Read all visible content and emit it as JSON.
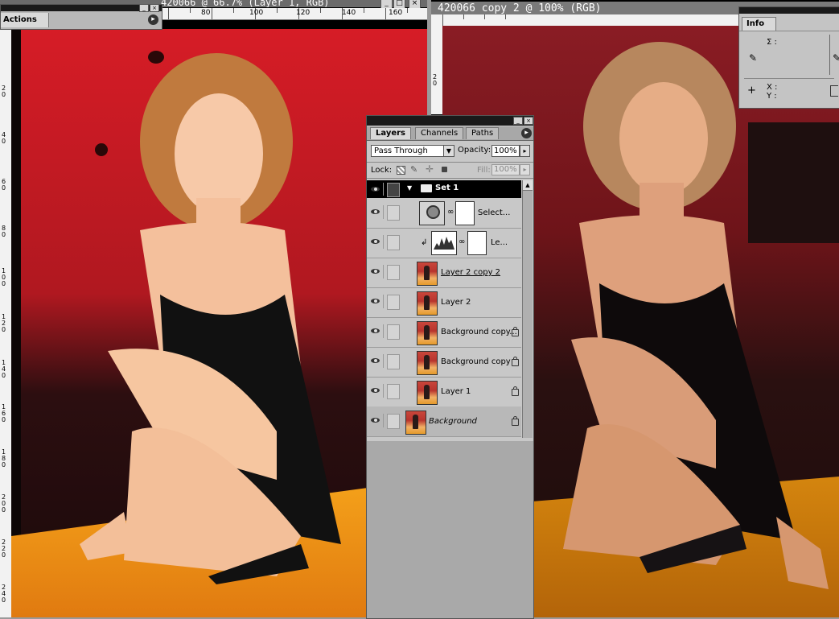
{
  "left_window": {
    "title": "420066 @ 66.7% (Layer 1, RGB)",
    "ruler_labels": [
      "80",
      "100",
      "120",
      "140",
      "160"
    ],
    "vruler_labels": [
      "20",
      "40",
      "60",
      "80",
      "100",
      "120",
      "140",
      "160",
      "180",
      "200",
      "220",
      "240"
    ],
    "btn_min": "_",
    "btn_max": "□",
    "btn_close": "×"
  },
  "right_window": {
    "title": "420066 copy 2 @ 100% (RGB)",
    "vruler_labels": [
      "20"
    ]
  },
  "actions_panel": {
    "tab": "Actions",
    "menu_arrow": "▸"
  },
  "info_panel": {
    "tab": "Info",
    "sigma_label": "Σ :",
    "x_label": "X :",
    "y_label": "Y :"
  },
  "layers_panel": {
    "tabs": [
      "Layers",
      "Channels",
      "Paths"
    ],
    "blend_mode": "Pass Through",
    "opacity_label": "Opacity:",
    "opacity_value": "100%",
    "lock_label": "Lock:",
    "fill_label": "Fill:",
    "fill_value": "100%",
    "set_name": "Set 1",
    "layers": [
      {
        "name": "Select...",
        "kind": "adjustment"
      },
      {
        "name": "Le...",
        "kind": "levels"
      },
      {
        "name": "Layer 2 copy 2",
        "kind": "image",
        "locked": false
      },
      {
        "name": "Layer 2",
        "kind": "image",
        "locked": false
      },
      {
        "name": "Background copy...",
        "kind": "image",
        "locked": true
      },
      {
        "name": "Background copy",
        "kind": "image",
        "locked": true
      },
      {
        "name": "Layer 1",
        "kind": "image",
        "locked": true
      },
      {
        "name": "Background",
        "kind": "image",
        "locked": true
      }
    ]
  },
  "colors": {
    "chrome": "#9a9a9a",
    "panel": "#cbcbcb",
    "set_row": "#000000",
    "titlebar": "#6b6b6b"
  }
}
